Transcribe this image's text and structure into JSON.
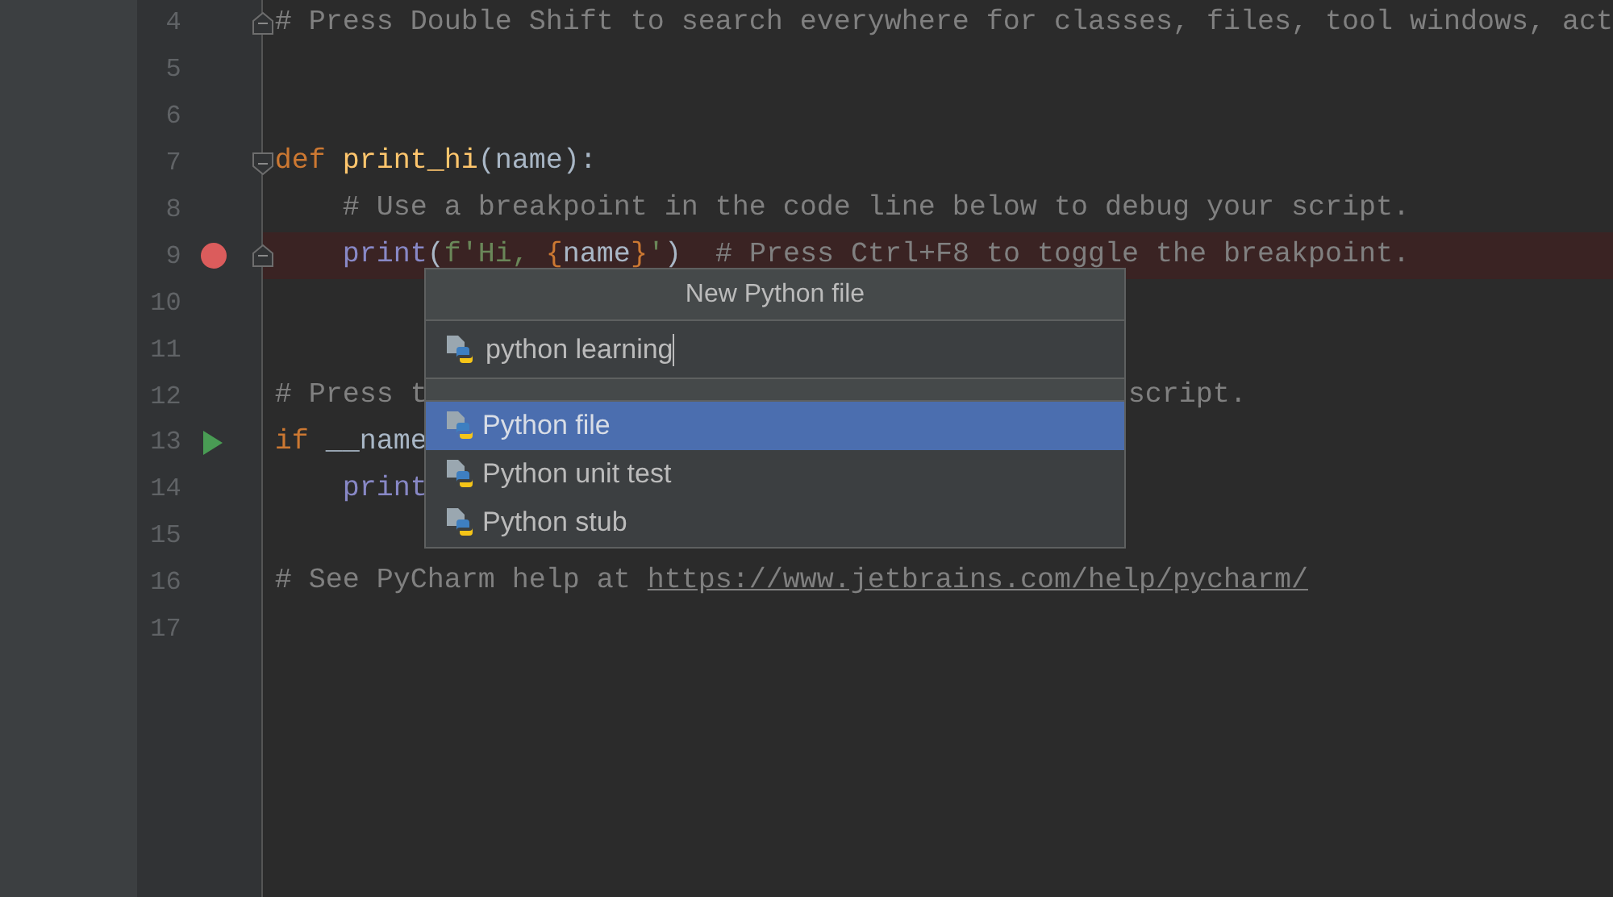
{
  "editor": {
    "lines": [
      {
        "number": "4",
        "fold_start": false,
        "fold_end": true,
        "breakpoint": false,
        "run": false,
        "highlighted": false,
        "parts": [
          {
            "kind": "comment",
            "text": "# Press Double Shift to search everywhere for classes, files, tool windows, act"
          }
        ]
      },
      {
        "number": "5",
        "fold_start": false,
        "fold_end": false,
        "breakpoint": false,
        "run": false,
        "highlighted": false
      },
      {
        "number": "6",
        "fold_start": false,
        "fold_end": false,
        "breakpoint": false,
        "run": false,
        "highlighted": false
      },
      {
        "number": "7",
        "fold_start": true,
        "fold_end": false,
        "breakpoint": false,
        "run": false,
        "highlighted": false,
        "parts": [
          {
            "kind": "keyword",
            "text": "def "
          },
          {
            "kind": "function",
            "text": "print_hi"
          },
          {
            "kind": "plain",
            "text": "(name):"
          }
        ]
      },
      {
        "number": "8",
        "fold_start": false,
        "fold_end": false,
        "breakpoint": false,
        "run": false,
        "highlighted": false,
        "parts": [
          {
            "kind": "comment",
            "text": "    # Use a breakpoint in the code line below to debug your script."
          }
        ]
      },
      {
        "number": "9",
        "fold_start": false,
        "fold_end": true,
        "breakpoint": true,
        "run": false,
        "highlighted": true,
        "parts": [
          {
            "kind": "builtin",
            "text": "    print"
          },
          {
            "kind": "plain",
            "text": "("
          },
          {
            "kind": "string",
            "text": "f'Hi, "
          },
          {
            "kind": "keyword",
            "text": "{"
          },
          {
            "kind": "plain",
            "text": "name"
          },
          {
            "kind": "keyword",
            "text": "}"
          },
          {
            "kind": "string",
            "text": "'"
          },
          {
            "kind": "plain",
            "text": ")  "
          },
          {
            "kind": "comment",
            "text": "# Press Ctrl+F8 to toggle the breakpoint."
          }
        ]
      },
      {
        "number": "10",
        "fold_start": false,
        "fold_end": false,
        "breakpoint": false,
        "run": false,
        "highlighted": false
      },
      {
        "number": "11",
        "fold_start": false,
        "fold_end": false,
        "breakpoint": false,
        "run": false,
        "highlighted": false
      },
      {
        "number": "12",
        "fold_start": false,
        "fold_end": false,
        "breakpoint": false,
        "run": false,
        "highlighted": false,
        "parts": [
          {
            "kind": "comment",
            "text": "# Press t"
          }
        ],
        "after_popup": [
          {
            "kind": "comment",
            "text": "script."
          }
        ]
      },
      {
        "number": "13",
        "fold_start": false,
        "fold_end": false,
        "breakpoint": false,
        "run": true,
        "highlighted": false,
        "parts": [
          {
            "kind": "keyword",
            "text": "if"
          },
          {
            "kind": "plain",
            "text": " __name"
          }
        ]
      },
      {
        "number": "14",
        "fold_start": false,
        "fold_end": false,
        "breakpoint": false,
        "run": false,
        "highlighted": false,
        "parts": [
          {
            "kind": "builtin",
            "text": "    print"
          }
        ]
      },
      {
        "number": "15",
        "fold_start": false,
        "fold_end": false,
        "breakpoint": false,
        "run": false,
        "highlighted": false
      },
      {
        "number": "16",
        "fold_start": false,
        "fold_end": false,
        "breakpoint": false,
        "run": false,
        "highlighted": false,
        "parts": [
          {
            "kind": "comment",
            "text": "# See PyCharm help at "
          },
          {
            "kind": "link",
            "text": "https://www.jetbrains.com/help/pycharm/"
          }
        ]
      },
      {
        "number": "17",
        "fold_start": false,
        "fold_end": false,
        "breakpoint": false,
        "run": false,
        "highlighted": false
      }
    ]
  },
  "dialog": {
    "title": "New Python file",
    "input": {
      "value": "python learning"
    },
    "items": [
      {
        "label": "Python file",
        "selected": true
      },
      {
        "label": "Python unit test",
        "selected": false
      },
      {
        "label": "Python stub",
        "selected": false
      }
    ]
  }
}
